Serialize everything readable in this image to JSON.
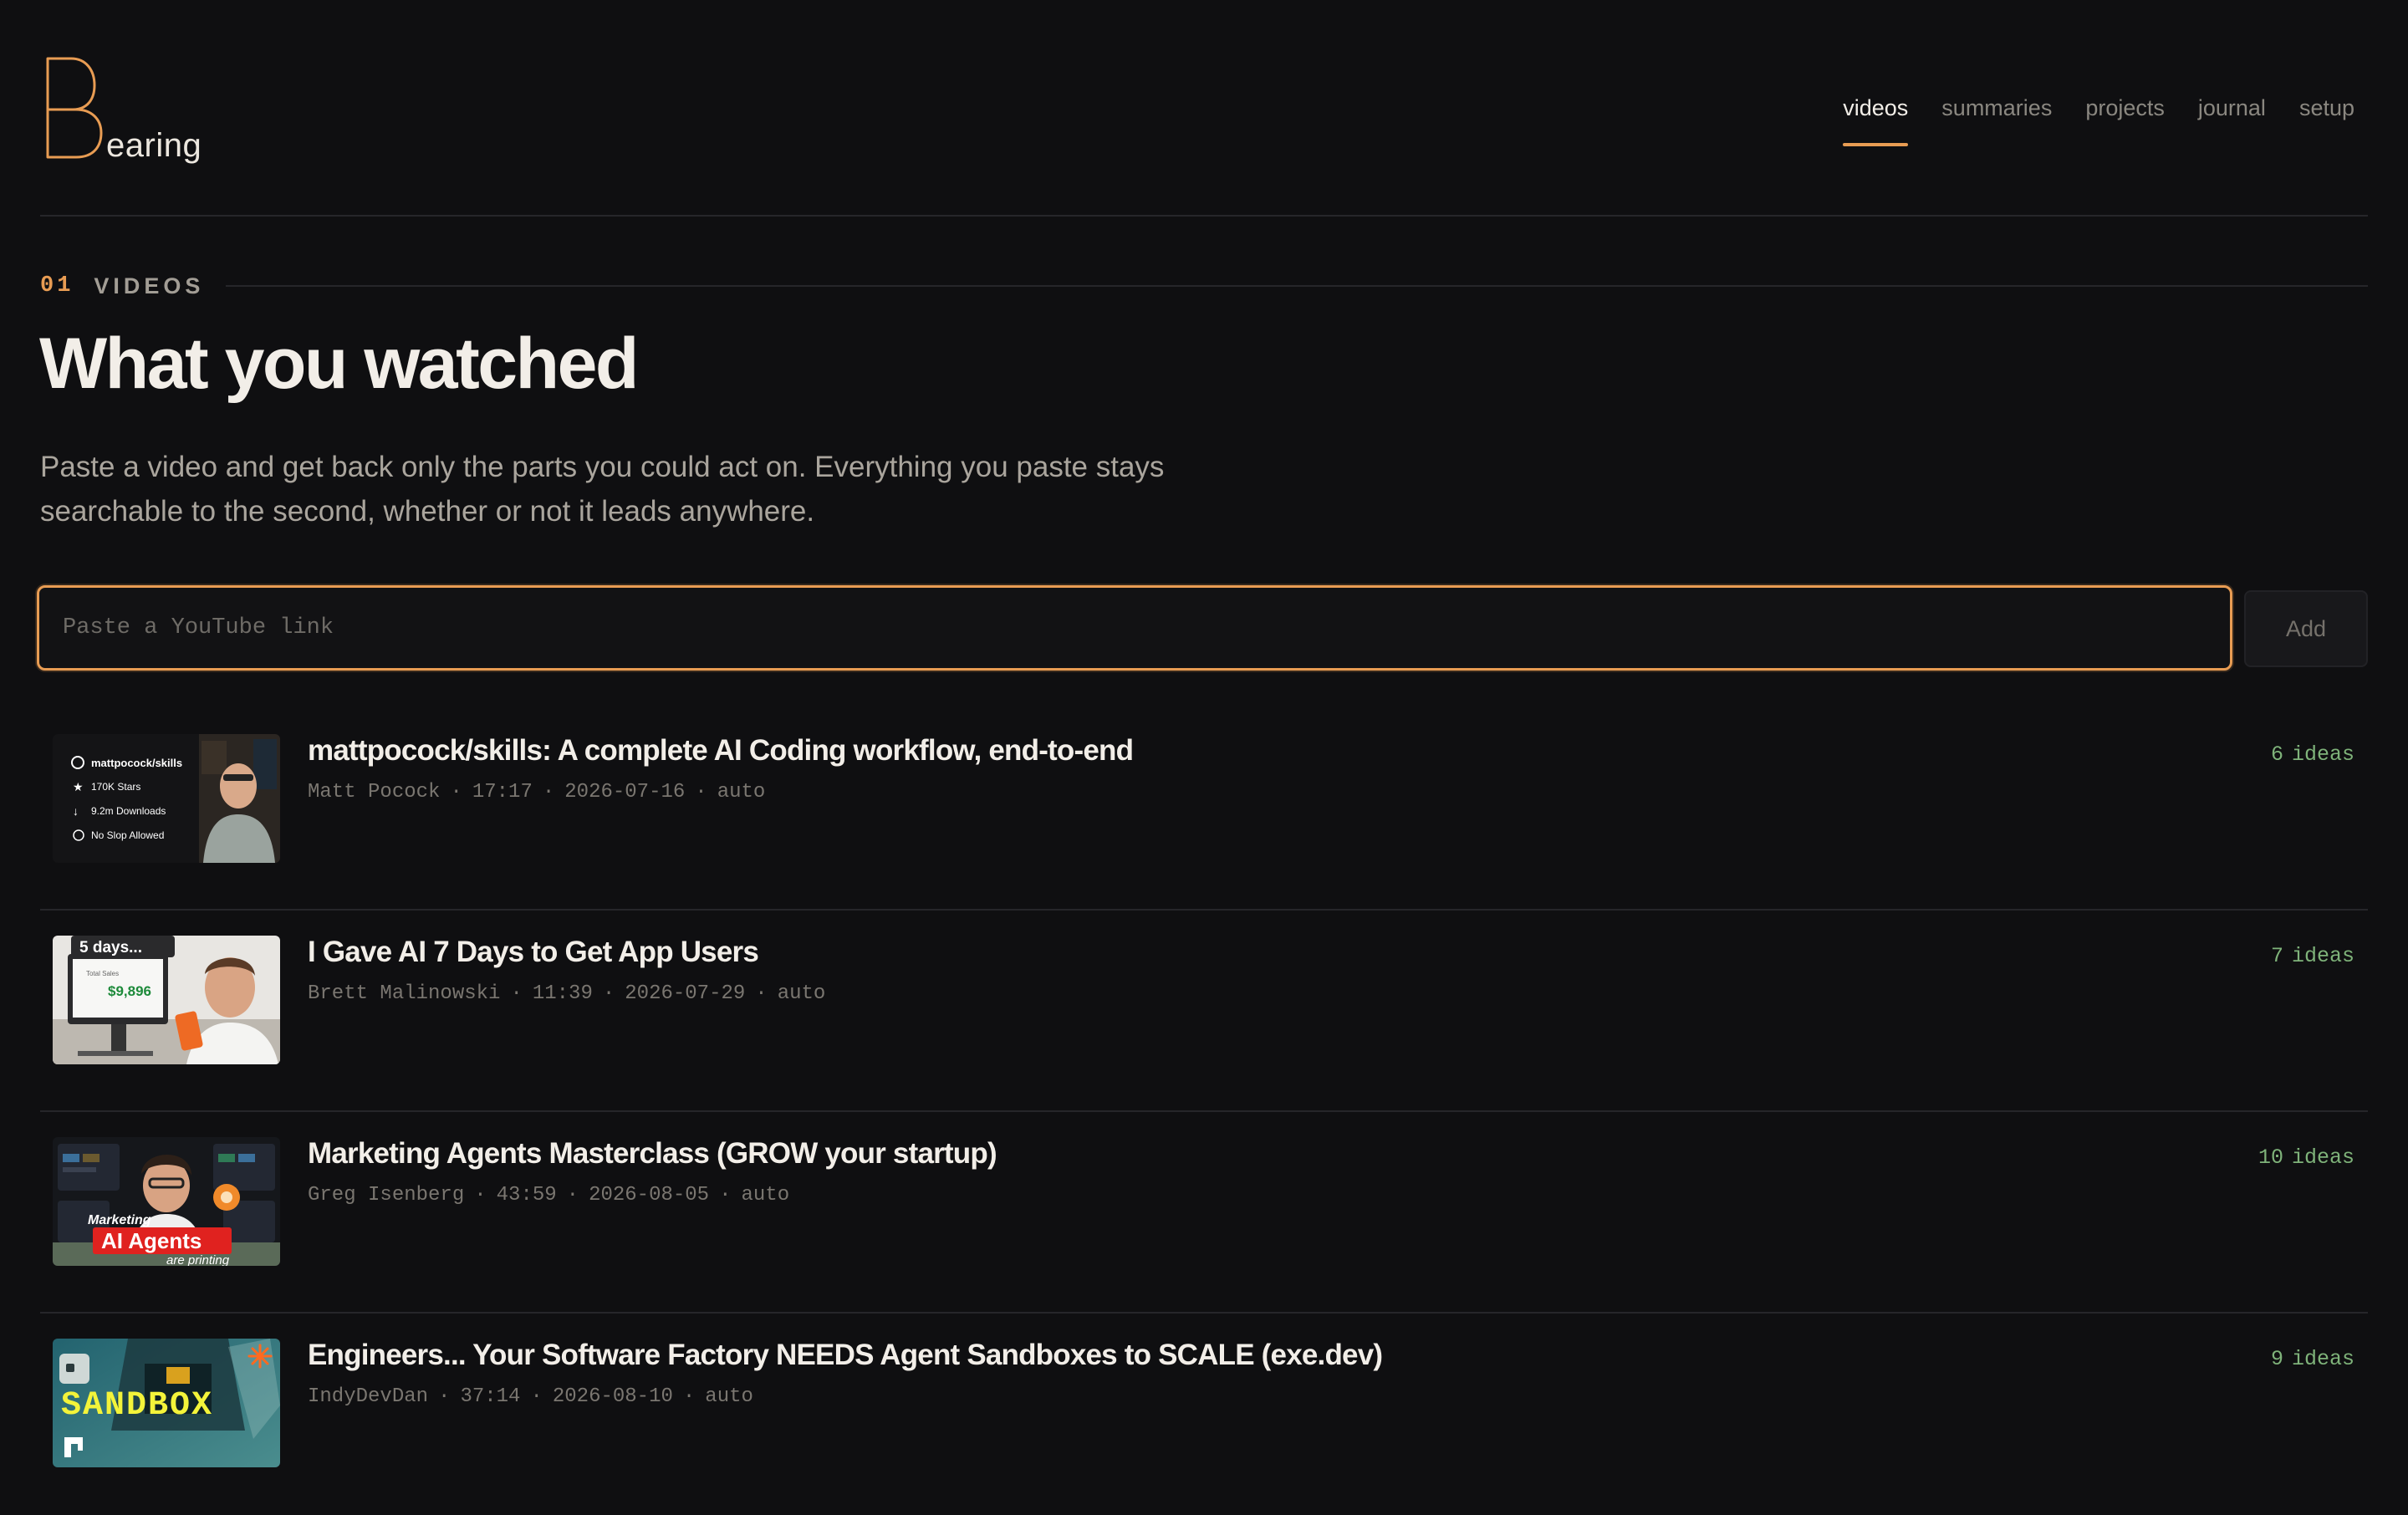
{
  "brand": {
    "initial": "B",
    "rest": "earing"
  },
  "nav": [
    {
      "label": "videos",
      "active": true
    },
    {
      "label": "summaries",
      "active": false
    },
    {
      "label": "projects",
      "active": false
    },
    {
      "label": "journal",
      "active": false
    },
    {
      "label": "setup",
      "active": false
    }
  ],
  "section": {
    "number": "01",
    "label": "VIDEOS",
    "title": "What you watched",
    "description": "Paste a video and get back only the parts you could act on. Everything you paste stays searchable to the second, whether or not it leads anywhere."
  },
  "input": {
    "placeholder": "Paste a YouTube link",
    "value": ""
  },
  "add_label": "Add",
  "videos": [
    {
      "title": "mattpocock/skills: A complete AI Coding workflow, end-to-end",
      "channel": "Matt Pocock",
      "duration": "17:17",
      "date": "2026-07-16",
      "mode": "auto",
      "ideas_count": "6",
      "ideas_unit": "ideas",
      "thumb": {
        "lines": [
          "mattpocock/skills",
          "170K Stars",
          "9.2m Downloads",
          "No Slop Allowed"
        ]
      }
    },
    {
      "title": "I Gave AI 7 Days to Get App Users",
      "channel": "Brett Malinowski",
      "duration": "11:39",
      "date": "2026-07-29",
      "mode": "auto",
      "ideas_count": "7",
      "ideas_unit": "ideas",
      "thumb": {
        "banner": "5 days...",
        "amount": "$9,896",
        "caption": "Total Sales"
      }
    },
    {
      "title": "Marketing Agents Masterclass (GROW your startup)",
      "channel": "Greg Isenberg",
      "duration": "43:59",
      "date": "2026-08-05",
      "mode": "auto",
      "ideas_count": "10",
      "ideas_unit": "ideas",
      "thumb": {
        "top": "Marketing",
        "main": "AI Agents",
        "bottom": "are printing"
      }
    },
    {
      "title": "Engineers... Your Software Factory NEEDS Agent Sandboxes to SCALE (exe.dev)",
      "channel": "IndyDevDan",
      "duration": "37:14",
      "date": "2026-08-10",
      "mode": "auto",
      "ideas_count": "9",
      "ideas_unit": "ideas",
      "thumb": {
        "word": "SANDBOX"
      }
    }
  ]
}
